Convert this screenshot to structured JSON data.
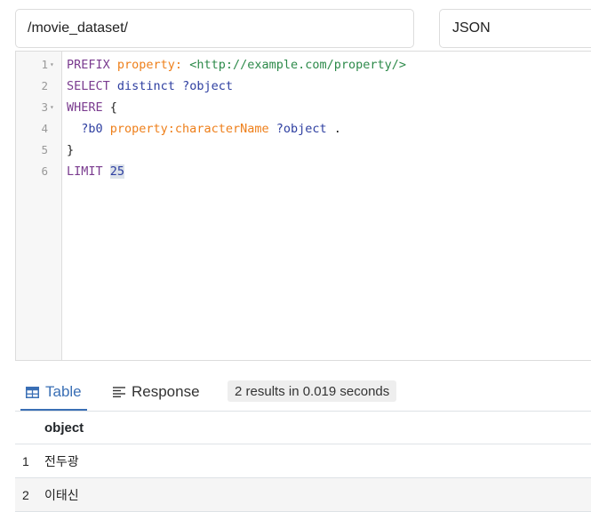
{
  "endpoint": {
    "value": "/movie_dataset/"
  },
  "format": {
    "selected": "JSON"
  },
  "editor": {
    "lines": [
      {
        "number": "1",
        "fold": "▾",
        "tokens": [
          {
            "t": "PREFIX ",
            "c": "kw"
          },
          {
            "t": "property:",
            "c": "pfx"
          },
          {
            "t": " ",
            "c": "plain"
          },
          {
            "t": "<http://example.com/property/>",
            "c": "iri"
          }
        ]
      },
      {
        "number": "2",
        "fold": "",
        "tokens": [
          {
            "t": "SELECT ",
            "c": "kw"
          },
          {
            "t": "distinct ",
            "c": "var"
          },
          {
            "t": "?object",
            "c": "var"
          }
        ]
      },
      {
        "number": "3",
        "fold": "▾",
        "tokens": [
          {
            "t": "WHERE ",
            "c": "kw"
          },
          {
            "t": "{",
            "c": "plain"
          }
        ]
      },
      {
        "number": "4",
        "fold": "",
        "tokens": [
          {
            "t": "  ?b0 ",
            "c": "var"
          },
          {
            "t": "property:characterName",
            "c": "pfx"
          },
          {
            "t": " ?object",
            "c": "var"
          },
          {
            "t": " .",
            "c": "plain"
          }
        ]
      },
      {
        "number": "5",
        "fold": "",
        "tokens": [
          {
            "t": "}",
            "c": "plain"
          }
        ]
      },
      {
        "number": "6",
        "fold": "",
        "tokens": [
          {
            "t": "LIMIT ",
            "c": "kw"
          },
          {
            "t": "25",
            "c": "num"
          }
        ]
      }
    ]
  },
  "tabs": {
    "table_label": "Table",
    "table_icon": "table-icon",
    "response_label": "Response",
    "response_icon": "align-left-icon",
    "result_summary": "2 results in 0.019 seconds"
  },
  "results": {
    "column_header": "object",
    "rows": [
      {
        "index": "1",
        "value": "전두광"
      },
      {
        "index": "2",
        "value": "이태신"
      }
    ]
  },
  "colors": {
    "accent": "#3a6fb5",
    "keyword": "#7a3b8f",
    "prefix": "#ee7f1a",
    "iri": "#2d8a4a",
    "variable": "#2d3ea0"
  }
}
